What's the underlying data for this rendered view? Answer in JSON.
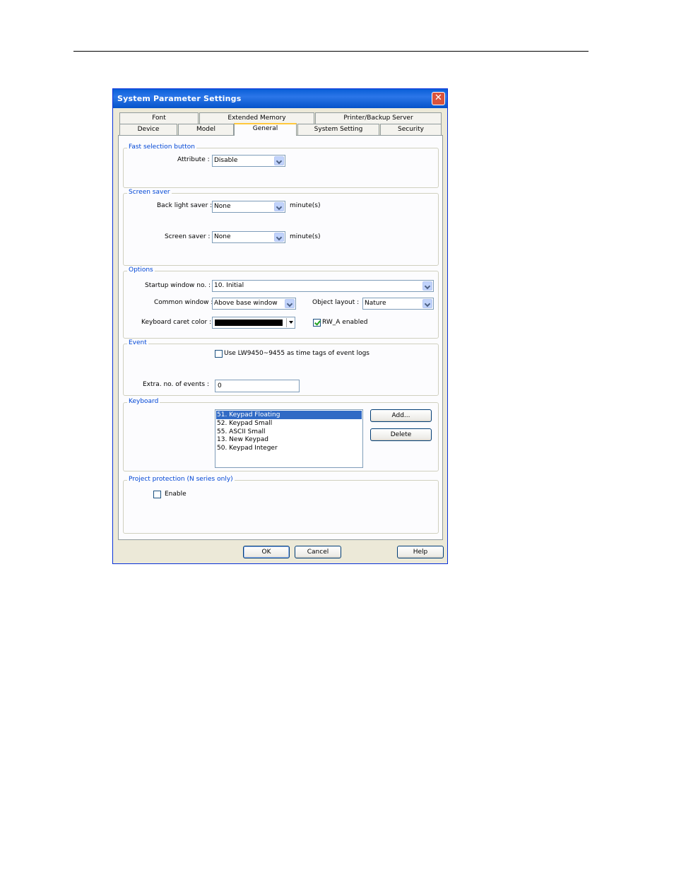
{
  "dialog": {
    "title": "System Parameter Settings",
    "tabs_row1": [
      "Font",
      "Extended Memory",
      "Printer/Backup Server"
    ],
    "tabs_row2": [
      "Device",
      "Model",
      "General",
      "System Setting",
      "Security"
    ],
    "active_tab": "General"
  },
  "fast_selection": {
    "title": "Fast selection button",
    "attribute_label": "Attribute :",
    "attribute_value": "Disable"
  },
  "screen_saver": {
    "title": "Screen saver",
    "backlight_label": "Back light saver :",
    "backlight_value": "None",
    "backlight_unit": "minute(s)",
    "screensaver_label": "Screen saver :",
    "screensaver_value": "None",
    "screensaver_unit": "minute(s)"
  },
  "options": {
    "title": "Options",
    "startup_label": "Startup window no. :",
    "startup_value": "10. Initial",
    "common_label": "Common window :",
    "common_value": "Above base window",
    "object_layout_label": "Object layout :",
    "object_layout_value": "Nature",
    "caret_label": "Keyboard caret color :",
    "caret_color": "#000000",
    "rw_label": "RW_A enabled",
    "rw_checked": true
  },
  "event": {
    "title": "Event",
    "use_lw_label": "Use LW9450~9455 as time tags of event logs",
    "use_lw_checked": false,
    "extra_label": "Extra. no. of events :",
    "extra_value": "0"
  },
  "keyboard": {
    "title": "Keyboard",
    "items": [
      "51. Keypad Floating",
      "52. Keypad Small",
      "55. ASCII Small",
      "13. New Keypad",
      "50. Keypad Integer"
    ],
    "selected_index": 0,
    "add_label": "Add...",
    "delete_label": "Delete"
  },
  "protection": {
    "title": "Project protection (N series only)",
    "enable_label": "Enable",
    "enable_checked": false
  },
  "footer": {
    "ok": "OK",
    "cancel": "Cancel",
    "help": "Help"
  }
}
